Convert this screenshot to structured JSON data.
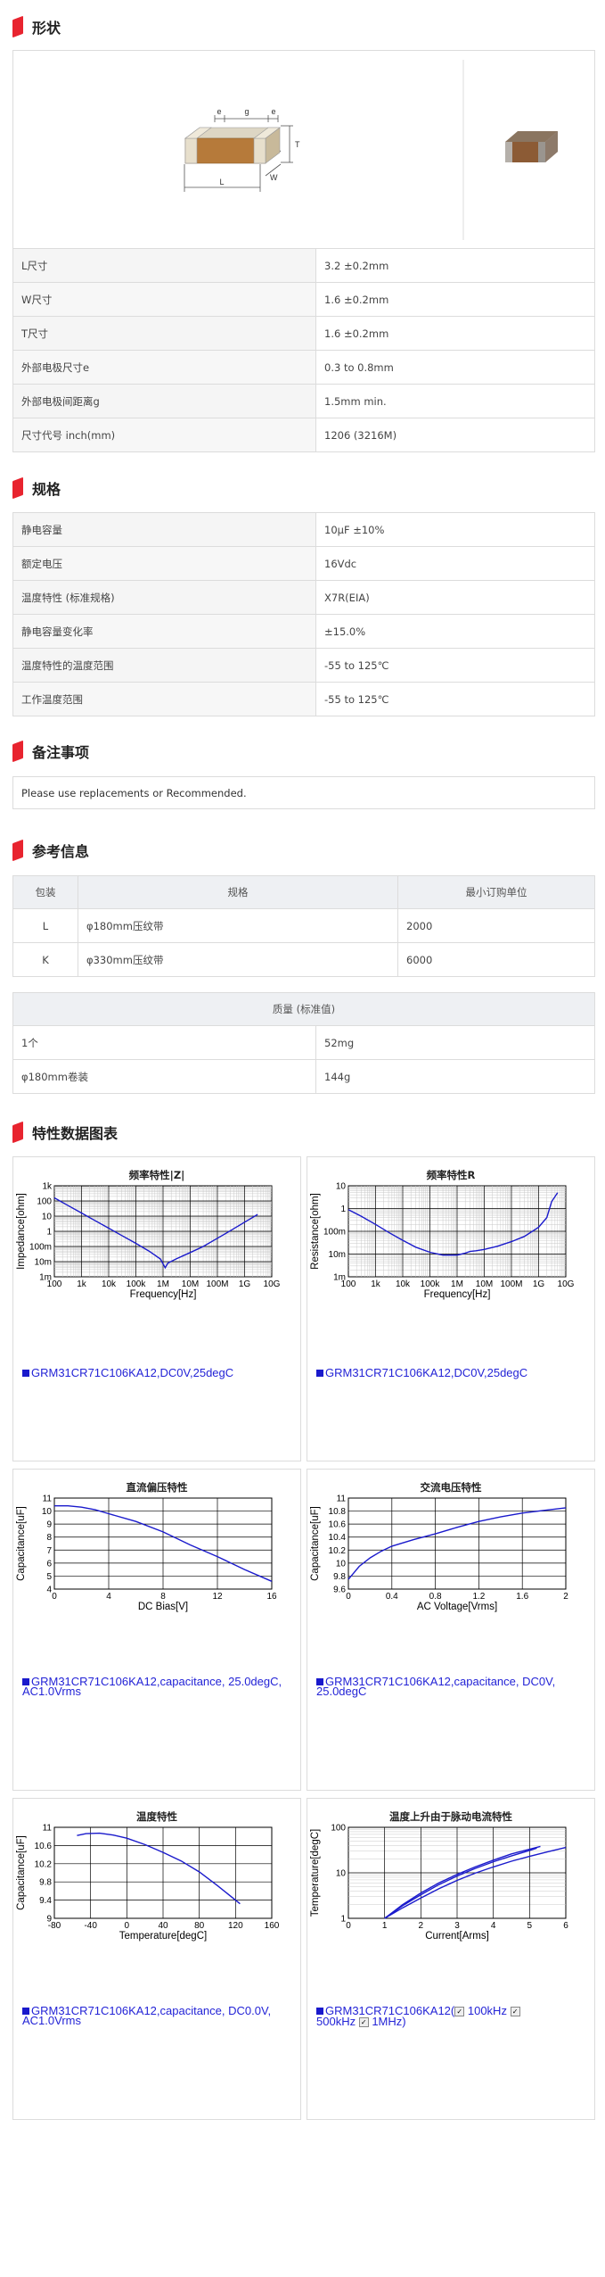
{
  "sections": {
    "shape": "形状",
    "spec": "规格",
    "notes": "备注事项",
    "reference": "参考信息",
    "charts": "特性数据图表"
  },
  "shape_table": [
    {
      "k": "L尺寸",
      "v": "3.2 ±0.2mm"
    },
    {
      "k": "W尺寸",
      "v": "1.6 ±0.2mm"
    },
    {
      "k": "T尺寸",
      "v": "1.6 ±0.2mm"
    },
    {
      "k": "外部电极尺寸e",
      "v": "0.3 to 0.8mm"
    },
    {
      "k": "外部电极间距离g",
      "v": "1.5mm min."
    },
    {
      "k": "尺寸代号 inch(mm)",
      "v": "1206 (3216M)"
    }
  ],
  "diagram_labels": {
    "e1": "e",
    "g": "g",
    "e2": "e",
    "t": "T",
    "l": "L",
    "w": "W"
  },
  "spec_table": [
    {
      "k": "静电容量",
      "v": "10μF ±10%"
    },
    {
      "k": "额定电压",
      "v": "16Vdc"
    },
    {
      "k": "温度特性 (标准规格)",
      "v": "X7R(EIA)"
    },
    {
      "k": "静电容量变化率",
      "v": "±15.0%"
    },
    {
      "k": "温度特性的温度范围",
      "v": "-55 to 125℃"
    },
    {
      "k": "工作温度范围",
      "v": "-55 to 125℃"
    }
  ],
  "notes_text": "Please use replacements or Recommended.",
  "packaging": {
    "headers": [
      "包装",
      "规格",
      "最小订购单位"
    ],
    "rows": [
      [
        "L",
        "φ180mm压纹带",
        "2000"
      ],
      [
        "K",
        "φ330mm压纹带",
        "6000"
      ]
    ]
  },
  "mass": {
    "header": "质量 (标准值)",
    "rows": [
      [
        "1个",
        "52mg"
      ],
      [
        "φ180mm卷装",
        "144g"
      ]
    ]
  },
  "chart_data": [
    {
      "type": "line",
      "title": "频率特性|Z|",
      "xlabel": "Frequency[Hz]",
      "ylabel": "Impedance[ohm]",
      "log_x": true,
      "log_y": true,
      "xticks": [
        "100",
        "1k",
        "10k",
        "100k",
        "1M",
        "10M",
        "100M",
        "1G",
        "10G"
      ],
      "yticks": [
        "1k",
        "100",
        "10",
        "1",
        "100m",
        "10m",
        "1m"
      ],
      "xlim": [
        100,
        10000000000
      ],
      "ylim": [
        0.001,
        1000
      ],
      "series": [
        {
          "name": "GRM31CR71C106KA12,DC0V,25degC",
          "x": [
            100,
            300,
            1000,
            3000,
            10000,
            30000,
            100000,
            300000,
            800000,
            1200000,
            1500000,
            3000000,
            10000000,
            30000000,
            100000000,
            300000000,
            1000000000,
            3000000000
          ],
          "y": [
            160,
            53,
            16,
            5.3,
            1.6,
            0.53,
            0.16,
            0.05,
            0.015,
            0.004,
            0.008,
            0.015,
            0.04,
            0.1,
            0.35,
            1.1,
            4,
            13
          ]
        }
      ]
    },
    {
      "type": "line",
      "title": "频率特性R",
      "xlabel": "Frequency[Hz]",
      "ylabel": "Resistance[ohm]",
      "log_x": true,
      "log_y": true,
      "xticks": [
        "100",
        "1k",
        "10k",
        "100k",
        "1M",
        "10M",
        "100M",
        "1G",
        "10G"
      ],
      "yticks": [
        "10",
        "1",
        "100m",
        "10m",
        "1m"
      ],
      "xlim": [
        100,
        10000000000
      ],
      "ylim": [
        0.001,
        10
      ],
      "series": [
        {
          "name": "GRM31CR71C106KA12,DC0V,25degC",
          "x": [
            100,
            300,
            1000,
            3000,
            10000,
            30000,
            100000,
            300000,
            1000000,
            2000000,
            3000000,
            5000000,
            10000000,
            30000000,
            100000000,
            300000000,
            1000000000,
            2000000000,
            3000000000,
            5000000000
          ],
          "y": [
            0.9,
            0.45,
            0.2,
            0.09,
            0.04,
            0.02,
            0.012,
            0.009,
            0.009,
            0.011,
            0.013,
            0.014,
            0.016,
            0.022,
            0.035,
            0.06,
            0.15,
            0.4,
            2,
            5
          ]
        }
      ]
    },
    {
      "type": "line",
      "title": "直流偏压特性",
      "xlabel": "DC Bias[V]",
      "ylabel": "Capacitance[uF]",
      "xticks": [
        "0",
        "4",
        "8",
        "12",
        "16"
      ],
      "yticks": [
        "11",
        "10",
        "9",
        "8",
        "7",
        "6",
        "5",
        "4"
      ],
      "xlim": [
        0,
        16
      ],
      "ylim": [
        4,
        11
      ],
      "series": [
        {
          "name": "GRM31CR71C106KA12,capacitance, 25.0degC, AC1.0Vrms",
          "x": [
            0,
            1,
            2,
            3,
            4,
            6,
            8,
            10,
            12,
            14,
            16
          ],
          "y": [
            10.4,
            10.4,
            10.3,
            10.1,
            9.8,
            9.2,
            8.4,
            7.4,
            6.5,
            5.5,
            4.6
          ]
        }
      ]
    },
    {
      "type": "line",
      "title": "交流电压特性",
      "xlabel": "AC Voltage[Vrms]",
      "ylabel": "Capacitance[uF]",
      "xticks": [
        "0",
        "0.4",
        "0.8",
        "1.2",
        "1.6",
        "2"
      ],
      "yticks": [
        "11",
        "10.8",
        "10.6",
        "10.4",
        "10.2",
        "10",
        "9.8",
        "9.6"
      ],
      "xlim": [
        0,
        2
      ],
      "ylim": [
        9.6,
        11
      ],
      "series": [
        {
          "name": "GRM31CR71C106KA12,capacitance, DC0V, 25.0degC",
          "x": [
            0,
            0.05,
            0.1,
            0.2,
            0.3,
            0.4,
            0.6,
            0.8,
            1.0,
            1.2,
            1.4,
            1.6,
            1.8,
            2.0
          ],
          "y": [
            9.75,
            9.85,
            9.95,
            10.08,
            10.18,
            10.26,
            10.36,
            10.45,
            10.55,
            10.64,
            10.71,
            10.77,
            10.81,
            10.85
          ]
        }
      ]
    },
    {
      "type": "line",
      "title": "温度特性",
      "xlabel": "Temperature[degC]",
      "ylabel": "Capacitance[uF]",
      "xticks": [
        "-80",
        "-40",
        "0",
        "40",
        "80",
        "120",
        "160"
      ],
      "yticks": [
        "11",
        "10.6",
        "10.2",
        "9.8",
        "9.4",
        "9"
      ],
      "xlim": [
        -80,
        160
      ],
      "ylim": [
        9,
        11
      ],
      "series": [
        {
          "name": "GRM31CR71C106KA12,capacitance, DC0.0V, AC1.0Vrms",
          "x": [
            -55,
            -45,
            -30,
            -15,
            0,
            20,
            40,
            60,
            80,
            100,
            125
          ],
          "y": [
            10.82,
            10.86,
            10.87,
            10.83,
            10.76,
            10.62,
            10.45,
            10.26,
            10.02,
            9.72,
            9.32
          ]
        }
      ]
    },
    {
      "type": "line",
      "title": "温度上升由于脉动电流特性",
      "xlabel": "Current[Arms]",
      "ylabel": "Temperature[degC]",
      "log_y": true,
      "xticks": [
        "0",
        "1",
        "2",
        "3",
        "4",
        "5",
        "6"
      ],
      "yticks": [
        "100",
        "10",
        "1"
      ],
      "xlim": [
        0,
        6
      ],
      "ylim": [
        1,
        100
      ],
      "series": [
        {
          "name": "100kHz",
          "x": [
            1,
            1.5,
            2,
            2.5,
            3,
            3.5,
            4,
            4.5,
            5,
            5.2
          ],
          "y": [
            1,
            1.9,
            3.3,
            5.5,
            8.5,
            12.5,
            17.5,
            23.5,
            31,
            35
          ]
        },
        {
          "name": "500kHz",
          "x": [
            1,
            1.5,
            2,
            2.5,
            3,
            3.5,
            4,
            4.5,
            5,
            5.3
          ],
          "y": [
            1,
            2,
            3.6,
            6,
            9.2,
            13.5,
            19,
            26,
            33,
            38
          ]
        },
        {
          "name": "1MHz",
          "x": [
            1,
            1.5,
            2,
            2.5,
            3,
            3.5,
            4,
            4.5,
            5,
            5.5,
            6
          ],
          "y": [
            1,
            1.7,
            2.8,
            4.5,
            6.8,
            9.8,
            13.5,
            18,
            23,
            29,
            36
          ]
        }
      ],
      "legend_prefix": "GRM31CR71C106KA12("
    }
  ]
}
